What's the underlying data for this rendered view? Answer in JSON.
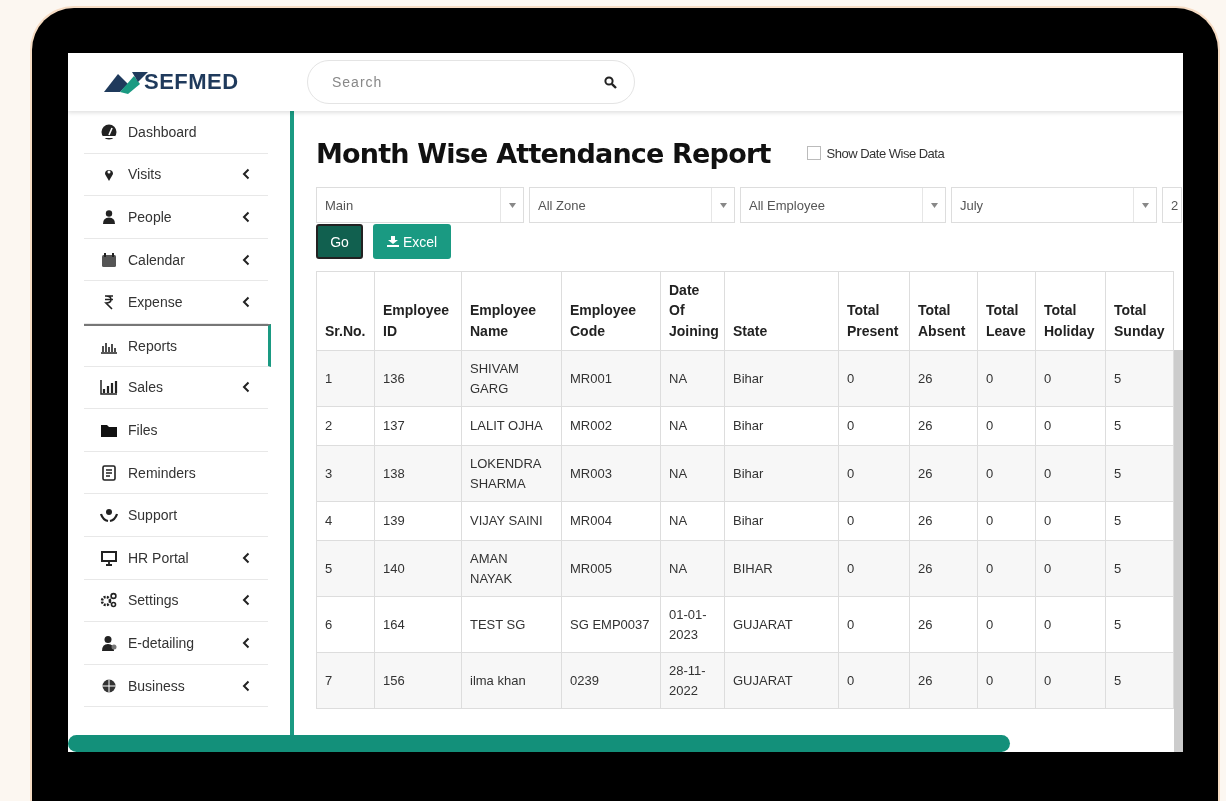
{
  "logo": {
    "text": "SEFMED"
  },
  "search": {
    "placeholder": "Search"
  },
  "sidebar": {
    "items": [
      {
        "label": "Dashboard",
        "expandable": false,
        "selected": false
      },
      {
        "label": "Visits",
        "expandable": true,
        "selected": false
      },
      {
        "label": "People",
        "expandable": true,
        "selected": false
      },
      {
        "label": "Calendar",
        "expandable": true,
        "selected": false
      },
      {
        "label": "Expense",
        "expandable": true,
        "selected": false
      },
      {
        "label": "Reports",
        "expandable": false,
        "selected": true
      },
      {
        "label": "Sales",
        "expandable": true,
        "selected": false
      },
      {
        "label": "Files",
        "expandable": false,
        "selected": false
      },
      {
        "label": "Reminders",
        "expandable": false,
        "selected": false
      },
      {
        "label": "Support",
        "expandable": false,
        "selected": false
      },
      {
        "label": "HR Portal",
        "expandable": true,
        "selected": false
      },
      {
        "label": "Settings",
        "expandable": true,
        "selected": false
      },
      {
        "label": "E-detailing",
        "expandable": true,
        "selected": false
      },
      {
        "label": "Business",
        "expandable": true,
        "selected": false
      }
    ]
  },
  "page": {
    "title": "Month Wise Attendance Report",
    "option": {
      "label": "Show Date Wise Data",
      "checked": false
    }
  },
  "filters": [
    {
      "value": "Main"
    },
    {
      "value": "All Zone"
    },
    {
      "value": "All Employee"
    },
    {
      "value": "July"
    },
    {
      "value": "2"
    }
  ],
  "buttons": {
    "go": "Go",
    "excel": "Excel"
  },
  "table": {
    "columns": [
      "Sr.No.",
      "Employee ID",
      "Employee Name",
      "Employee Code",
      "Date Of Joining",
      "State",
      "Total Present",
      "Total Absent",
      "Total Leave",
      "Total Holiday",
      "Total Sunday"
    ],
    "rows": [
      [
        "1",
        "136",
        "SHIVAM GARG",
        "MR001",
        "NA",
        "Bihar",
        "0",
        "26",
        "0",
        "0",
        "5"
      ],
      [
        "2",
        "137",
        "LALIT OJHA",
        "MR002",
        "NA",
        "Bihar",
        "0",
        "26",
        "0",
        "0",
        "5"
      ],
      [
        "3",
        "138",
        "LOKENDRA SHARMA",
        "MR003",
        "NA",
        "Bihar",
        "0",
        "26",
        "0",
        "0",
        "5"
      ],
      [
        "4",
        "139",
        "VIJAY SAINI",
        "MR004",
        "NA",
        "Bihar",
        "0",
        "26",
        "0",
        "0",
        "5"
      ],
      [
        "5",
        "140",
        "AMAN NAYAK",
        "MR005",
        "NA",
        "BIHAR",
        "0",
        "26",
        "0",
        "0",
        "5"
      ],
      [
        "6",
        "164",
        "TEST SG",
        "SG EMP0037",
        "01-01-2023",
        "GUJARAT",
        "0",
        "26",
        "0",
        "0",
        "5"
      ],
      [
        "7",
        "156",
        "ilma khan",
        "0239",
        "28-11-2022",
        "GUJARAT",
        "0",
        "26",
        "0",
        "0",
        "5"
      ]
    ]
  }
}
